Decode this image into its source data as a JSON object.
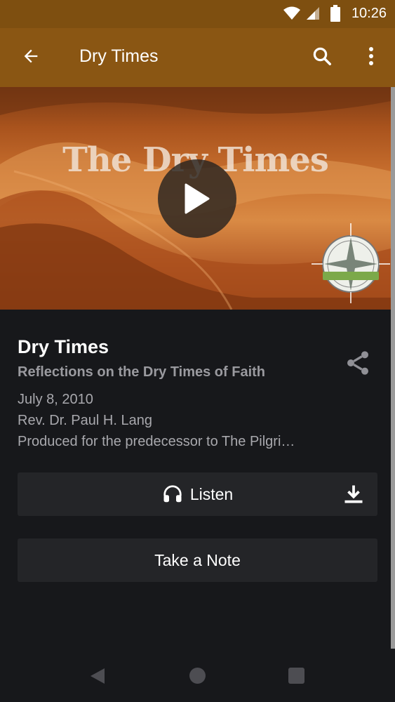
{
  "status_bar": {
    "time": "10:26"
  },
  "app_bar": {
    "title": "Dry Times"
  },
  "hero": {
    "title_text": "The Dry Times"
  },
  "episode": {
    "title": "Dry Times",
    "subtitle": "Reflections on the Dry Times of Faith",
    "date": "July 8, 2010",
    "speaker": "Rev. Dr. Paul H. Lang",
    "description": "Produced for the predecessor to The Pilgri…"
  },
  "actions": {
    "listen_label": "Listen",
    "note_label": "Take a Note"
  },
  "icons": {
    "back": "arrow-left-icon",
    "search": "search-icon",
    "more": "more-vert-icon",
    "play": "play-icon",
    "share": "share-icon",
    "headphones": "headphones-icon",
    "download": "download-icon",
    "wifi": "wifi-icon",
    "signal": "signal-icon",
    "battery": "battery-icon"
  },
  "colors": {
    "status_bar": "#7e4f10",
    "app_bar": "#8a5613",
    "background": "#17181b",
    "button": "#242528"
  }
}
